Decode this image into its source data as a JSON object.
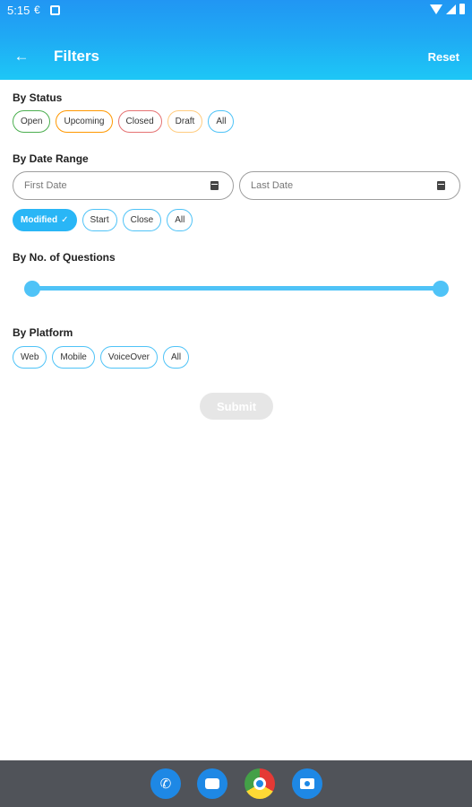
{
  "status_bar": {
    "time": "5:15",
    "icon_a": "€"
  },
  "header": {
    "title": "Filters",
    "reset_label": "Reset",
    "back_icon": "arrow-left-icon"
  },
  "status_section": {
    "label": "By Status",
    "chips": [
      "Open",
      "Upcoming",
      "Closed",
      "Draft",
      "All"
    ]
  },
  "date_section": {
    "label": "By Date Range",
    "first_placeholder": "First Date",
    "last_placeholder": "Last Date",
    "chips": [
      "Modified",
      "Start",
      "Close",
      "All"
    ],
    "selected_chip": "Modified",
    "selected_mark": "✓"
  },
  "questions_section": {
    "label": "By No. of Questions",
    "range_low": 0,
    "range_high": 1
  },
  "platform_section": {
    "label": "By Platform",
    "chips": [
      "Web",
      "Mobile",
      "VoiceOver",
      "All"
    ]
  },
  "submit_label": "Submit",
  "colors": {
    "header_gradient": [
      "#2196f3",
      "#1ec7f6"
    ],
    "accent": "#4fc3f7",
    "selected_chip": "#29b6f6",
    "open": "#4caf50",
    "upcoming": "#ff9800",
    "closed": "#e57373",
    "draft": "#ffcc80"
  },
  "dock_icons": [
    "phone-icon",
    "messages-icon",
    "chrome-icon",
    "camera-icon"
  ]
}
